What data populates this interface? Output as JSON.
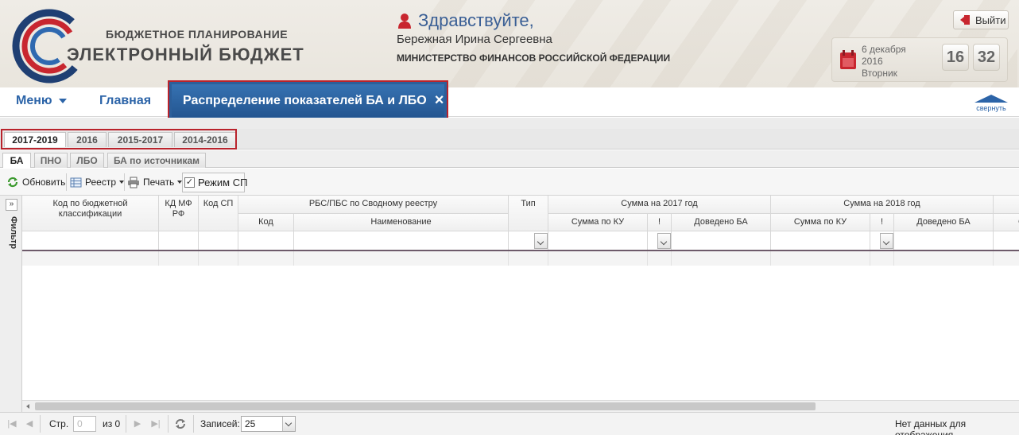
{
  "header": {
    "logo_top": "БЮДЖЕТНОЕ ПЛАНИРОВАНИЕ",
    "logo_bottom": "ЭЛЕКТРОННЫЙ БЮДЖЕТ",
    "greeting": "Здравствуйте,",
    "user_name": "Бережная Ирина Сергеевна",
    "ministry": "МИНИСТЕРСТВО ФИНАНСОВ РОССИЙСКОЙ ФЕДЕРАЦИИ",
    "logout_label": "Выйти",
    "date_day": "6 декабря",
    "date_year": "2016",
    "weekday": "Вторник",
    "clock_hours": "16",
    "clock_minutes": "32"
  },
  "nav": {
    "menu_label": "Меню",
    "home_label": "Главная",
    "active_tab_label": "Распределение показателей БА и ЛБО",
    "active_tab_close": "×",
    "collapse_label": "свернуть"
  },
  "year_tabs": [
    {
      "label": "2017-2019"
    },
    {
      "label": "2016"
    },
    {
      "label": "2015-2017"
    },
    {
      "label": "2014-2016"
    }
  ],
  "sub_tabs": [
    {
      "label": "БА"
    },
    {
      "label": "ПНО"
    },
    {
      "label": "ЛБО"
    },
    {
      "label": "БА по источникам"
    }
  ],
  "toolbar": {
    "refresh_label": "Обновить",
    "registry_label": "Реестр",
    "print_label": "Печать",
    "mode_label": "Режим СП",
    "mode_checked_mark": "✓"
  },
  "filter": {
    "toggle_symbol": "»",
    "label": "Фильтр"
  },
  "grid": {
    "col_kbk": "Код по бюджетной классификации",
    "col_kdmf": "КД МФ РФ",
    "col_kodsp": "Код СП",
    "col_rbs_group": "РБС/ПБС по Сводному реестру",
    "col_rbs_code": "Код",
    "col_rbs_name": "Наименование",
    "col_type": "Тип",
    "col_sum2017": "Сумма на 2017 год",
    "col_sum2018": "Сумма на 2018 год",
    "col_sum_ku": "Сумма по КУ",
    "col_excl": "!",
    "col_dovedeno": "Доведено БА",
    "col_sum_ku_2": "Сумма по КУ",
    "col_excl_2": "!",
    "col_dovedeno_2": "Доведено БА",
    "col_next_partial": "С"
  },
  "paging": {
    "page_label": "Стр.",
    "page_value": "0",
    "of_label": "из 0",
    "records_label": "Записей:",
    "records_value": "25",
    "empty_message": "Нет данных для отображения"
  },
  "colors": {
    "accent_blue": "#2c64a8",
    "active_tab": "#2c5f9a",
    "highlight_red": "#b9232c"
  }
}
